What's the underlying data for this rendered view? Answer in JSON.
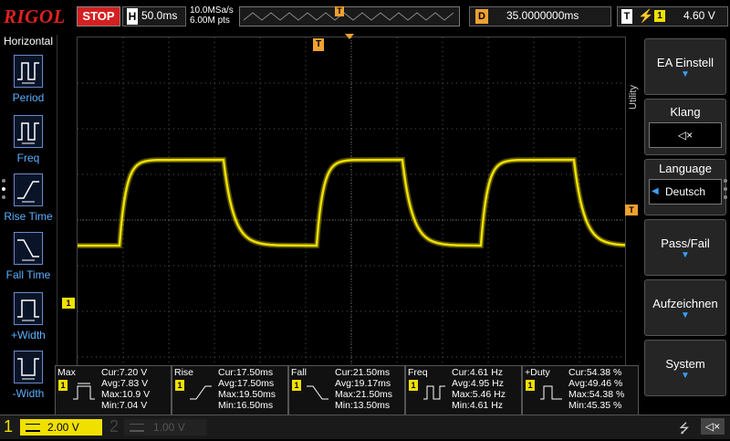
{
  "header": {
    "brand": "RIGOL",
    "run_state": "STOP",
    "horizontal_label": "H",
    "timebase": "50.0ms",
    "sample_rate": "10.0MSa/s",
    "memory_depth": "6.00M pts",
    "memory_marker": "T",
    "delay_label": "D",
    "delay_value": "35.0000000ms",
    "trigger_label": "T",
    "trigger_channel": "1",
    "trigger_level": "4.60 V"
  },
  "left_panel": {
    "title": "Horizontal",
    "items": [
      {
        "label": "Period",
        "icon": "period-icon"
      },
      {
        "label": "Freq",
        "icon": "freq-icon"
      },
      {
        "label": "Rise Time",
        "icon": "rise-time-icon"
      },
      {
        "label": "Fall Time",
        "icon": "fall-time-icon"
      },
      {
        "label": "+Width",
        "icon": "positive-width-icon"
      },
      {
        "label": "-Width",
        "icon": "negative-width-icon"
      }
    ]
  },
  "right_menu": {
    "side_label": "Utility",
    "buttons": [
      {
        "label": "EA Einstell",
        "value": ""
      },
      {
        "label": "Klang",
        "value": "◁×"
      },
      {
        "label": "Language",
        "value": "Deutsch"
      },
      {
        "label": "Pass/Fail",
        "value": ""
      },
      {
        "label": "Aufzeichnen",
        "value": ""
      },
      {
        "label": "System",
        "value": ""
      }
    ]
  },
  "markers": {
    "trigger_pos": "T",
    "channel1": "1"
  },
  "measurements": [
    {
      "name": "Max",
      "cur": "Cur:7.20 V",
      "avg": "Avg:7.83 V",
      "max": "Max:10.9 V",
      "min": "Min:7.04 V"
    },
    {
      "name": "Rise",
      "cur": "Cur:17.50ms",
      "avg": "Avg:17.50ms",
      "max": "Max:19.50ms",
      "min": "Min:16.50ms"
    },
    {
      "name": "Fall",
      "cur": "Cur:21.50ms",
      "avg": "Avg:19.17ms",
      "max": "Max:21.50ms",
      "min": "Min:13.50ms"
    },
    {
      "name": "Freq",
      "cur": "Cur:4.61 Hz",
      "avg": "Avg:4.95 Hz",
      "max": "Max:5.46 Hz",
      "min": "Min:4.61 Hz"
    },
    {
      "name": "+Duty",
      "cur": "Cur:54.38 %",
      "avg": "Avg:49.46 %",
      "max": "Max:54.38 %",
      "min": "Min:45.35 %"
    }
  ],
  "footer": {
    "ch1_label": "1",
    "ch1_scale": "2.00 V",
    "ch2_label": "2",
    "ch2_scale": "1.00 V"
  },
  "colors": {
    "trace": "#f0e000",
    "brand": "#e02020",
    "accent": "#3aa0ff",
    "trigger": "#f0a030"
  }
}
